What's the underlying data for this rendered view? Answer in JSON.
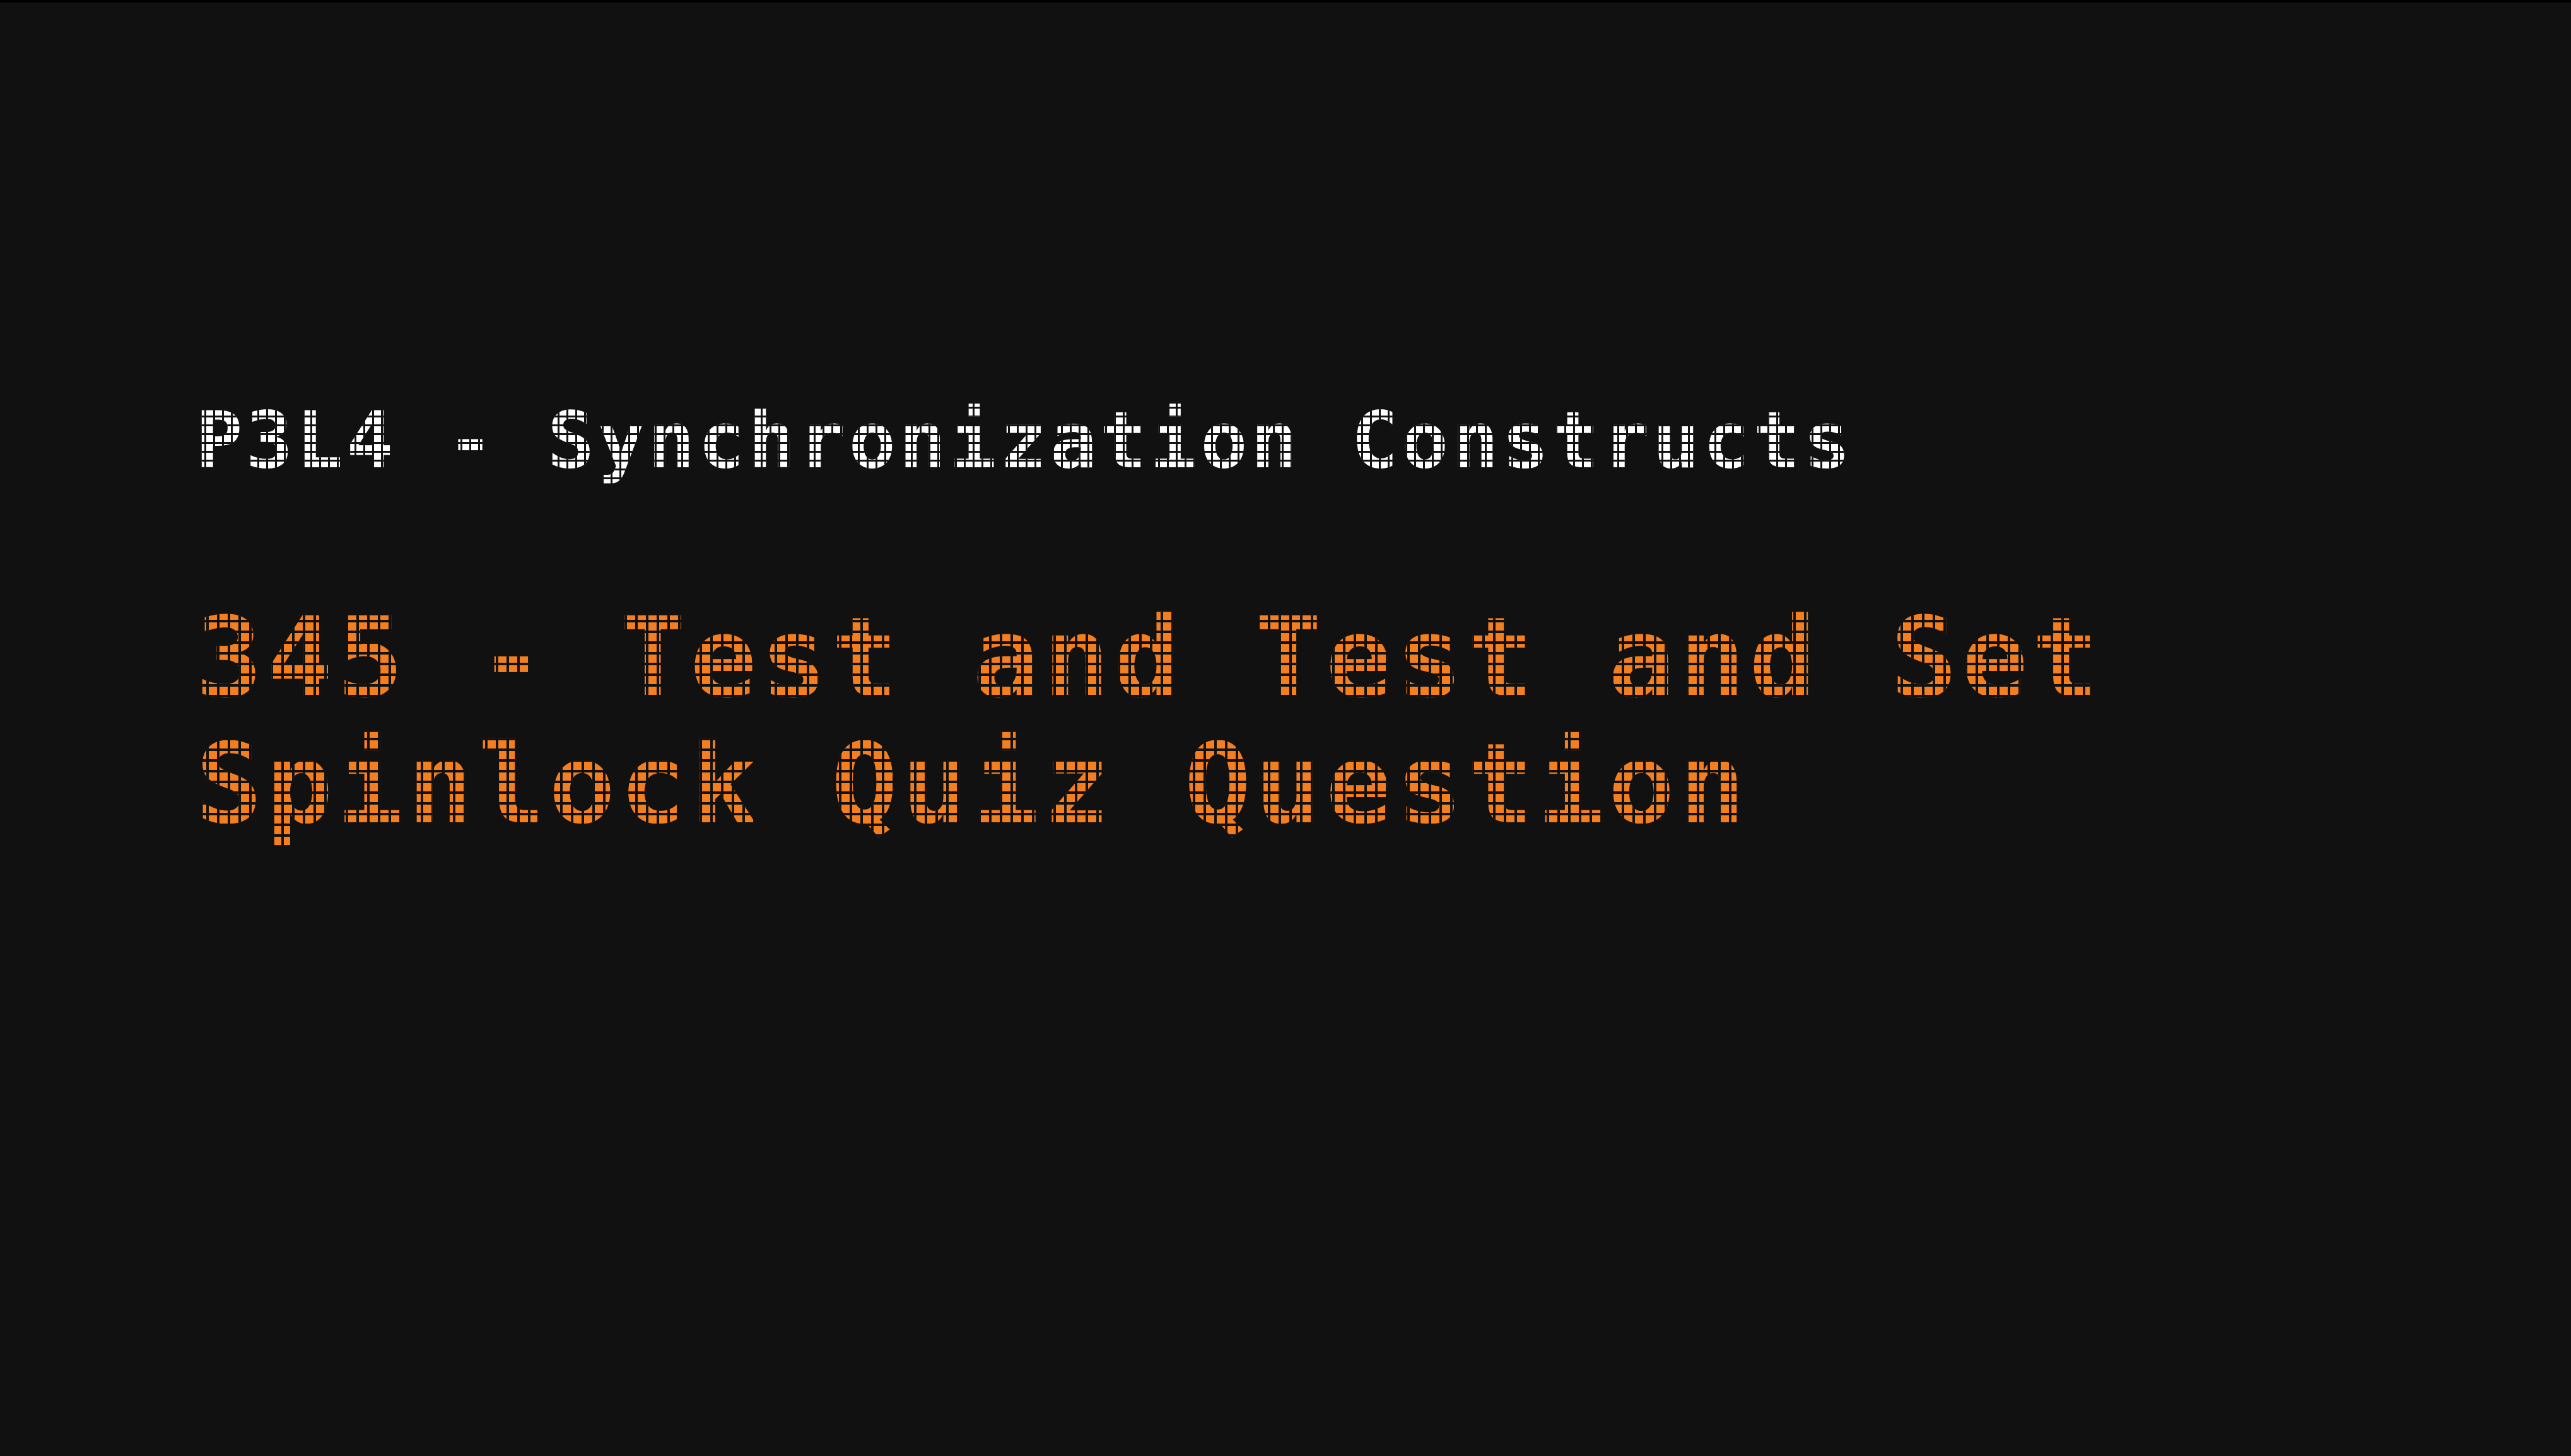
{
  "slide": {
    "course_title": "P3L4 - Synchronization Constructs",
    "lesson_title_line1": "345 - Test and Test and Set",
    "lesson_title_line2": "Spinlock Quiz Question"
  },
  "colors": {
    "background": "#111111",
    "course_title": "#ffffff",
    "lesson_title": "#f57f1f"
  }
}
